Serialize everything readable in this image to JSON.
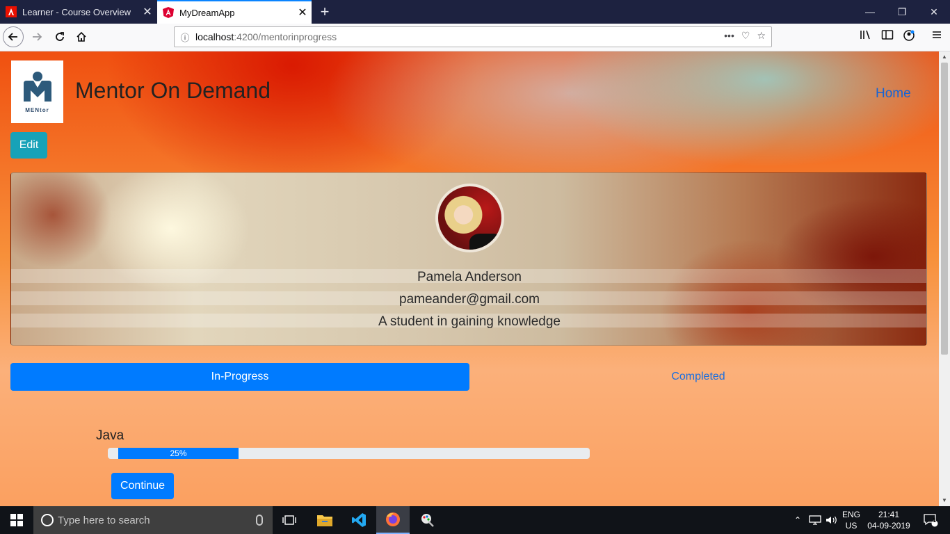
{
  "browser": {
    "tabs": [
      {
        "title": "Learner - Course Overview",
        "icon": "adobe-icon"
      },
      {
        "title": "MyDreamApp",
        "icon": "angular-icon"
      }
    ],
    "url": {
      "host": "localhost",
      "path": ":4200/mentorinprogress"
    }
  },
  "header": {
    "logo_caption": "MENtor",
    "title": "Mentor On Demand",
    "home_link": "Home"
  },
  "edit_button": "Edit",
  "profile": {
    "name": "Pamela Anderson",
    "email": "pameander@gmail.com",
    "bio": "A student in gaining knowledge"
  },
  "tabs": {
    "in_progress": "In-Progress",
    "completed": "Completed"
  },
  "course": {
    "name": "Java",
    "progress_label": "25%",
    "progress_fraction": 0.25,
    "continue_label": "Continue"
  },
  "taskbar": {
    "search_placeholder": "Type here to search",
    "lang_line1": "ENG",
    "lang_line2": "US",
    "time": "21:41",
    "date": "04-09-2019",
    "notification_count": "1"
  },
  "colors": {
    "primary": "#007bff",
    "info": "#17a2b8",
    "link": "#1464d6"
  }
}
